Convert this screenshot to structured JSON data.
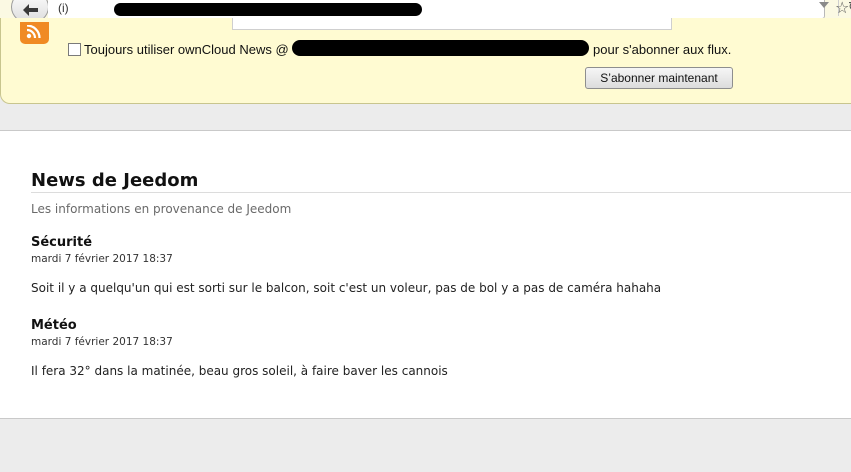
{
  "browser": {
    "url_prefix": "(i)",
    "reload_glyph": "↻",
    "bookmark_glyph": "☆"
  },
  "subscribe_bar": {
    "always_label_start": "Toujours utiliser ownCloud News @",
    "always_label_end": "pour s'abonner aux flux.",
    "always_checked": false,
    "button_label": "S’abonner maintenant"
  },
  "feed": {
    "title": "News de Jeedom",
    "subtitle": "Les informations en provenance de Jeedom",
    "entries": [
      {
        "title": "Sécurité",
        "date": "mardi 7 février 2017 18:37",
        "body": "Soit il y a quelqu'un qui est sorti sur le balcon, soit c'est un voleur, pas de bol y a pas de caméra hahaha"
      },
      {
        "title": "Météo",
        "date": "mardi 7 février 2017 18:37",
        "body": "Il fera 32° dans la matinée, beau gros soleil, à faire baver les cannois"
      }
    ]
  },
  "colors": {
    "notification_bar": "#fffbd2",
    "rss_orange": "#f08a24",
    "page_background": "#ececec"
  }
}
